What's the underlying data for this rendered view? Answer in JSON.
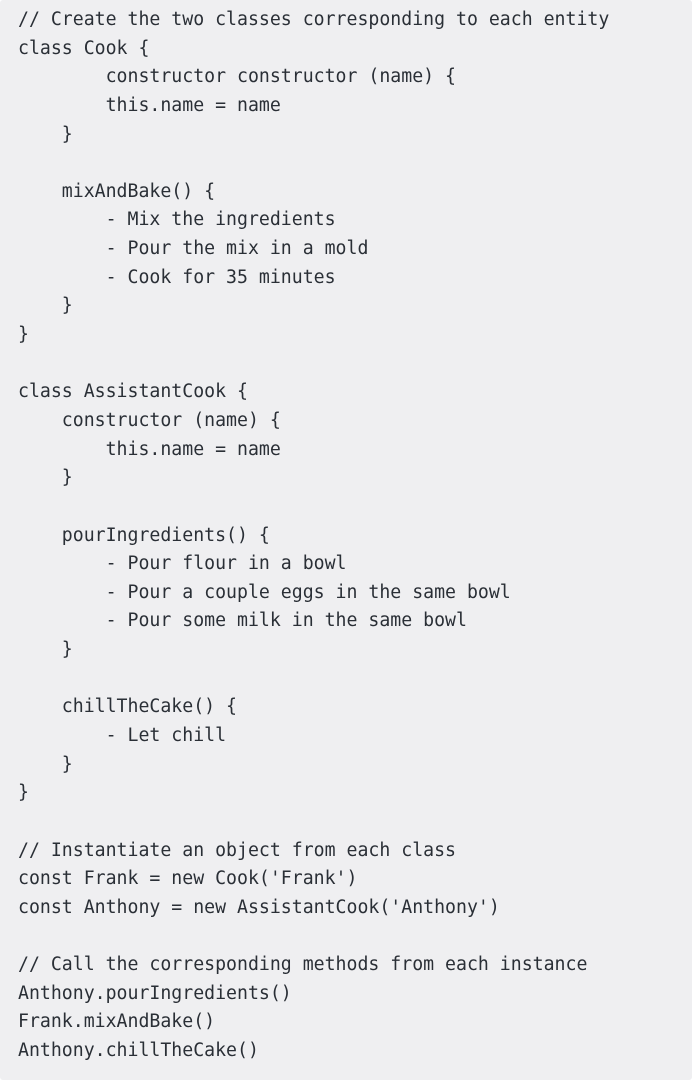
{
  "code": {
    "lines": [
      "// Create the two classes corresponding to each entity",
      "class Cook {",
      "        constructor constructor (name) {",
      "        this.name = name",
      "    }",
      "",
      "    mixAndBake() {",
      "        - Mix the ingredients",
      "        - Pour the mix in a mold",
      "        - Cook for 35 minutes",
      "    }",
      "}",
      "",
      "class AssistantCook {",
      "    constructor (name) {",
      "        this.name = name",
      "    }",
      "",
      "    pourIngredients() {",
      "        - Pour flour in a bowl",
      "        - Pour a couple eggs in the same bowl",
      "        - Pour some milk in the same bowl",
      "    }",
      "",
      "    chillTheCake() {",
      "        - Let chill",
      "    }",
      "}",
      "",
      "// Instantiate an object from each class",
      "const Frank = new Cook('Frank')",
      "const Anthony = new AssistantCook('Anthony')",
      "",
      "// Call the corresponding methods from each instance",
      "Anthony.pourIngredients()",
      "Frank.mixAndBake()",
      "Anthony.chillTheCake()"
    ]
  }
}
